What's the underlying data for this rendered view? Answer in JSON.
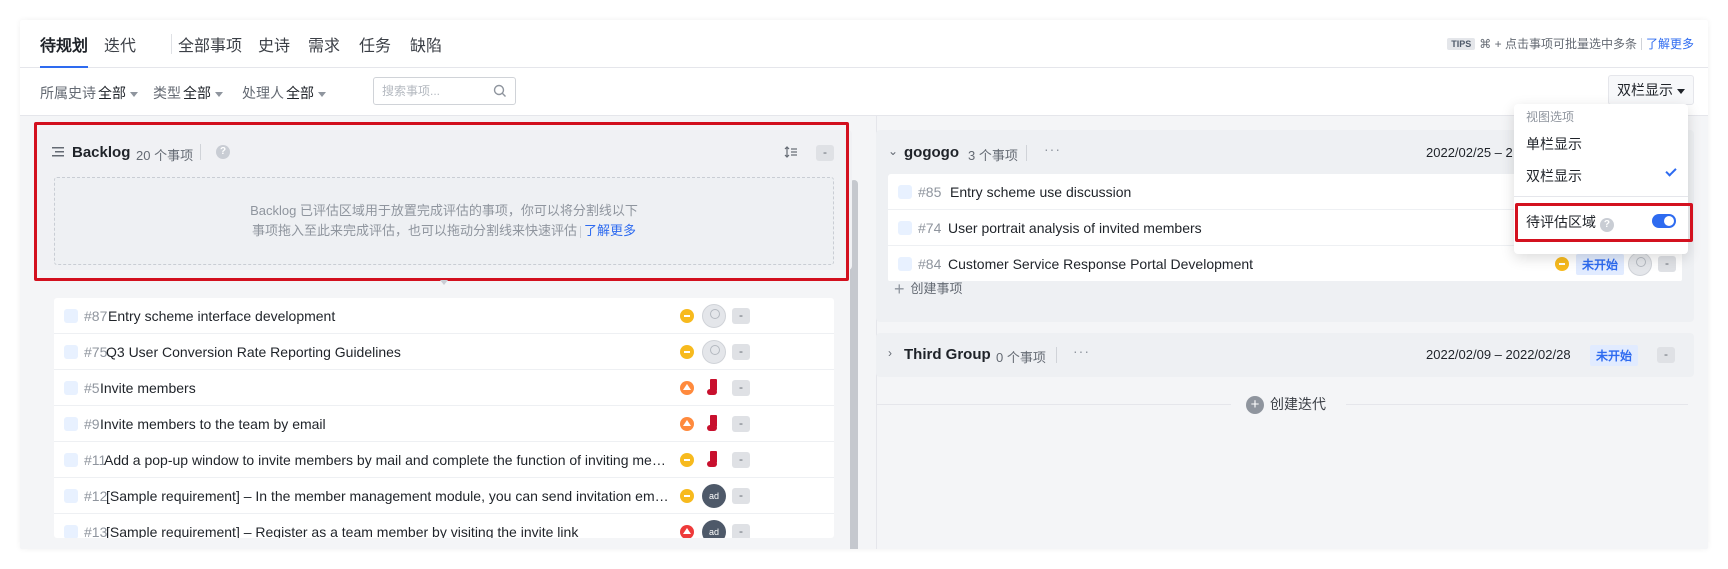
{
  "tabs": [
    {
      "label": "待规划",
      "active": true
    },
    {
      "label": "迭代",
      "active": false
    },
    {
      "label": "全部事项",
      "active": false
    },
    {
      "label": "史诗",
      "active": false
    },
    {
      "label": "需求",
      "active": false
    },
    {
      "label": "任务",
      "active": false
    },
    {
      "label": "缺陷",
      "active": false
    }
  ],
  "tips": {
    "tag": "TIPS",
    "text": "⌘ + 点击事项可批量选中多条",
    "link": "了解更多"
  },
  "filters": {
    "epic": {
      "label": "所属史诗",
      "value": "全部"
    },
    "type": {
      "label": "类型",
      "value": "全部"
    },
    "assignee": {
      "label": "处理人",
      "value": "全部"
    },
    "search_placeholder": "搜索事项..."
  },
  "view_button": "双栏显示",
  "backlog": {
    "title": "Backlog",
    "count": "20 个事项",
    "drop_zone_line1": "Backlog 已评估区域用于放置完成评估的事项，你可以将分割线以下",
    "drop_zone_line2": "事项拖入至此来完成评估，也可以拖动分割线来快速评估",
    "drop_zone_link": "了解更多",
    "min_label": "-",
    "issues": [
      {
        "num": "#87",
        "title": "Entry scheme interface development",
        "type": "task",
        "prio": "mid",
        "avatar": "empty"
      },
      {
        "num": "#75",
        "title": "Q3 User Conversion Rate Reporting Guidelines",
        "type": "req",
        "prio": "mid",
        "avatar": "empty"
      },
      {
        "num": "#5",
        "title": "Invite members",
        "type": "req",
        "prio": "high",
        "avatar": "sock"
      },
      {
        "num": "#9",
        "title": "Invite members to the team by email",
        "type": "req",
        "prio": "high",
        "avatar": "sock"
      },
      {
        "num": "#11",
        "title": "Add a pop-up window to invite members by mail and complete the function of inviting memb...",
        "type": "task",
        "prio": "mid",
        "avatar": "sock"
      },
      {
        "num": "#12",
        "title": "[Sample requirement] – In the member management module, you can send invitation emails i...",
        "type": "req",
        "prio": "mid",
        "avatar": "ad"
      },
      {
        "num": "#13",
        "title": "[Sample requirement] – Register as a team member by visiting the invite link",
        "type": "req",
        "prio": "urgent",
        "avatar": "ad"
      }
    ]
  },
  "groups": [
    {
      "title": "gogogo",
      "count": "3 个事项",
      "date": "2022/02/25 – 2",
      "issues": [
        {
          "num": "#85",
          "title": "Entry scheme use discussion",
          "type": "task"
        },
        {
          "num": "#74",
          "title": "User portrait analysis of invited members",
          "type": "req"
        },
        {
          "num": "#84",
          "title": "Customer Service Response Portal Development",
          "type": "req",
          "status": "未开始"
        }
      ],
      "add_label": "创建事项"
    },
    {
      "title": "Third Group",
      "count": "0 个事项",
      "date": "2022/02/09 – 2022/02/28",
      "status": "未开始"
    }
  ],
  "create_iteration": "创建迭代",
  "dropdown": {
    "section_label": "视图选项",
    "single": "单栏显示",
    "double": "双栏显示",
    "eval_area": "待评估区域"
  },
  "colors": {
    "accent": "#2e6bf0",
    "highlight": "#d3111f"
  }
}
